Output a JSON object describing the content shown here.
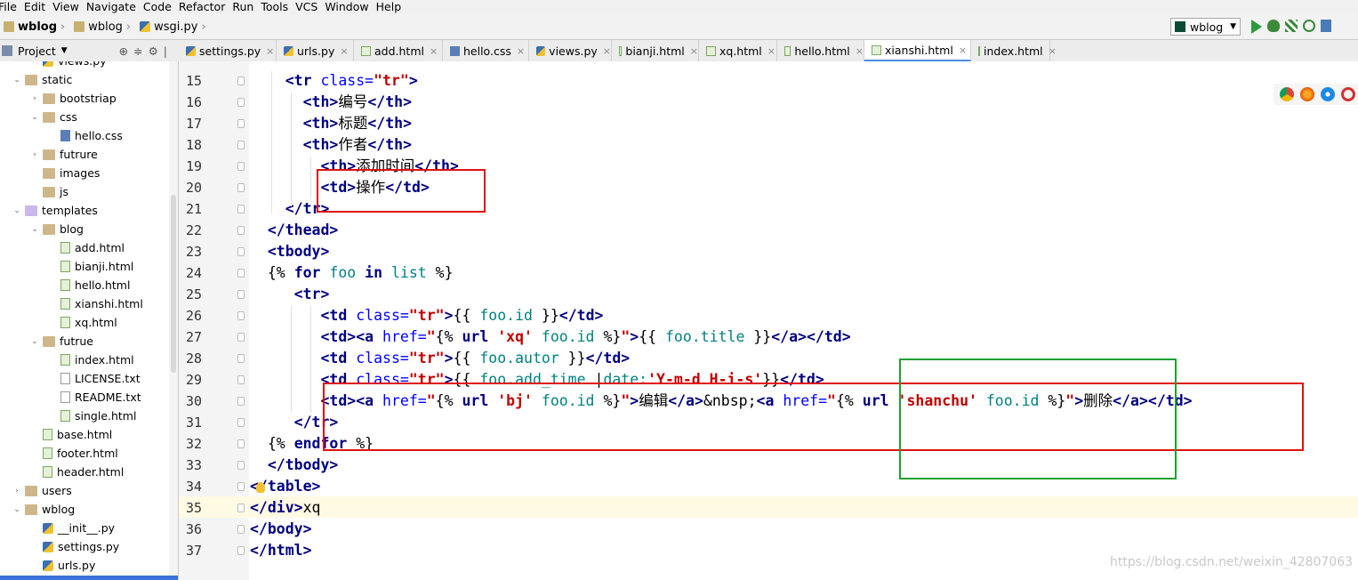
{
  "menu": [
    "File",
    "Edit",
    "View",
    "Navigate",
    "Code",
    "Refactor",
    "Run",
    "Tools",
    "VCS",
    "Window",
    "Help"
  ],
  "breadcrumb": [
    "wblog",
    "wblog",
    "wsgi.py"
  ],
  "run_config": "wblog",
  "project_panel": {
    "label": "Project"
  },
  "tabs": [
    {
      "label": "settings.py",
      "kind": "py"
    },
    {
      "label": "urls.py",
      "kind": "py"
    },
    {
      "label": "add.html",
      "kind": "html"
    },
    {
      "label": "hello.css",
      "kind": "css"
    },
    {
      "label": "views.py",
      "kind": "py"
    },
    {
      "label": "bianji.html",
      "kind": "html"
    },
    {
      "label": "xq.html",
      "kind": "html"
    },
    {
      "label": "hello.html",
      "kind": "html"
    },
    {
      "label": "xianshi.html",
      "kind": "html",
      "active": true
    },
    {
      "label": "index.html",
      "kind": "html"
    }
  ],
  "tree": [
    {
      "label": "views.py",
      "depth": 2,
      "kind": "py"
    },
    {
      "label": "static",
      "depth": 1,
      "kind": "folder",
      "open": true
    },
    {
      "label": "bootstriap",
      "depth": 2,
      "kind": "folder",
      "open": false
    },
    {
      "label": "css",
      "depth": 2,
      "kind": "folder",
      "open": true
    },
    {
      "label": "hello.css",
      "depth": 3,
      "kind": "css"
    },
    {
      "label": "futrure",
      "depth": 2,
      "kind": "folder",
      "open": false
    },
    {
      "label": "images",
      "depth": 2,
      "kind": "folder"
    },
    {
      "label": "js",
      "depth": 2,
      "kind": "folder"
    },
    {
      "label": "templates",
      "depth": 1,
      "kind": "tpl",
      "open": true
    },
    {
      "label": "blog",
      "depth": 2,
      "kind": "folder",
      "open": true
    },
    {
      "label": "add.html",
      "depth": 3,
      "kind": "html"
    },
    {
      "label": "bianji.html",
      "depth": 3,
      "kind": "html"
    },
    {
      "label": "hello.html",
      "depth": 3,
      "kind": "html"
    },
    {
      "label": "xianshi.html",
      "depth": 3,
      "kind": "html"
    },
    {
      "label": "xq.html",
      "depth": 3,
      "kind": "html"
    },
    {
      "label": "futrue",
      "depth": 2,
      "kind": "folder",
      "open": true
    },
    {
      "label": "index.html",
      "depth": 3,
      "kind": "html"
    },
    {
      "label": "LICENSE.txt",
      "depth": 3,
      "kind": "txt"
    },
    {
      "label": "README.txt",
      "depth": 3,
      "kind": "txt"
    },
    {
      "label": "single.html",
      "depth": 3,
      "kind": "html"
    },
    {
      "label": "base.html",
      "depth": 2,
      "kind": "html"
    },
    {
      "label": "footer.html",
      "depth": 2,
      "kind": "html"
    },
    {
      "label": "header.html",
      "depth": 2,
      "kind": "html"
    },
    {
      "label": "users",
      "depth": 1,
      "kind": "folder",
      "open": false
    },
    {
      "label": "wblog",
      "depth": 1,
      "kind": "folder",
      "open": true
    },
    {
      "label": "__init__.py",
      "depth": 2,
      "kind": "py"
    },
    {
      "label": "settings.py",
      "depth": 2,
      "kind": "py"
    },
    {
      "label": "urls.py",
      "depth": 2,
      "kind": "py"
    }
  ],
  "code_lines": [
    {
      "n": "15",
      "indent": "    ",
      "tokens": [
        [
          "tg",
          "<tr "
        ],
        [
          "at",
          "class="
        ],
        [
          "st",
          "\"tr\""
        ],
        [
          "tg",
          ">"
        ]
      ]
    },
    {
      "n": "16",
      "indent": "      ",
      "tokens": [
        [
          "tg",
          "<th>"
        ],
        [
          "tx",
          "编号"
        ],
        [
          "tg",
          "</th>"
        ]
      ]
    },
    {
      "n": "17",
      "indent": "      ",
      "tokens": [
        [
          "tg",
          "<th>"
        ],
        [
          "tx",
          "标题"
        ],
        [
          "tg",
          "</th>"
        ]
      ]
    },
    {
      "n": "18",
      "indent": "      ",
      "tokens": [
        [
          "tg",
          "<th>"
        ],
        [
          "tx",
          "作者"
        ],
        [
          "tg",
          "</th>"
        ]
      ]
    },
    {
      "n": "19",
      "indent": "        ",
      "tokens": [
        [
          "tg",
          "<th>"
        ],
        [
          "tx",
          "添加时间"
        ],
        [
          "tg",
          "</th>"
        ]
      ]
    },
    {
      "n": "20",
      "indent": "        ",
      "tokens": [
        [
          "tg",
          "<td>"
        ],
        [
          "tx",
          "操作"
        ],
        [
          "tg",
          "</td>"
        ]
      ]
    },
    {
      "n": "21",
      "indent": "    ",
      "tokens": [
        [
          "tg",
          "</tr>"
        ]
      ]
    },
    {
      "n": "22",
      "indent": "  ",
      "tokens": [
        [
          "tg",
          "</thead>"
        ]
      ]
    },
    {
      "n": "23",
      "indent": "  ",
      "tokens": [
        [
          "tg",
          "<tbody>"
        ]
      ]
    },
    {
      "n": "24",
      "indent": "  ",
      "tokens": [
        [
          "tx",
          "{% "
        ],
        [
          "kw",
          "for"
        ],
        [
          "vr",
          " foo "
        ],
        [
          "kw",
          "in"
        ],
        [
          "vr",
          " list "
        ],
        [
          "tx",
          "%}"
        ]
      ]
    },
    {
      "n": "25",
      "indent": "     ",
      "tokens": [
        [
          "tg",
          "<tr>"
        ]
      ]
    },
    {
      "n": "26",
      "indent": "        ",
      "tokens": [
        [
          "tg",
          "<td "
        ],
        [
          "at",
          "class="
        ],
        [
          "st",
          "\"tr\""
        ],
        [
          "tg",
          ">"
        ],
        [
          "tx",
          "{{ "
        ],
        [
          "vr",
          "foo.id"
        ],
        [
          "tx",
          " }}"
        ],
        [
          "tg",
          "</td>"
        ]
      ]
    },
    {
      "n": "27",
      "indent": "        ",
      "tokens": [
        [
          "tg",
          "<td><a "
        ],
        [
          "at",
          "href="
        ],
        [
          "st",
          "\""
        ],
        [
          "tx",
          "{% "
        ],
        [
          "kw",
          "url "
        ],
        [
          "st",
          "'xq'"
        ],
        [
          "vr",
          " foo.id "
        ],
        [
          "tx",
          "%}"
        ],
        [
          "st",
          "\""
        ],
        [
          "tg",
          ">"
        ],
        [
          "tx",
          "{{ "
        ],
        [
          "vr",
          "foo.title"
        ],
        [
          "tx",
          " }}"
        ],
        [
          "tg",
          "</a></td>"
        ]
      ]
    },
    {
      "n": "28",
      "indent": "        ",
      "tokens": [
        [
          "tg",
          "<td "
        ],
        [
          "at",
          "class="
        ],
        [
          "st",
          "\"tr\""
        ],
        [
          "tg",
          ">"
        ],
        [
          "tx",
          "{{ "
        ],
        [
          "vr",
          "foo.autor"
        ],
        [
          "tx",
          " }}"
        ],
        [
          "tg",
          "</td>"
        ]
      ]
    },
    {
      "n": "29",
      "indent": "        ",
      "tokens": [
        [
          "tg",
          "<td "
        ],
        [
          "at",
          "class="
        ],
        [
          "st",
          "\"tr\""
        ],
        [
          "tg",
          ">"
        ],
        [
          "tx",
          "{{ "
        ],
        [
          "vr",
          "foo.add_time "
        ],
        [
          "tx",
          "|"
        ],
        [
          "vr",
          "date:"
        ],
        [
          "st",
          "'Y-m-d H-i-s'"
        ],
        [
          "tx",
          "}}"
        ],
        [
          "tg",
          "</td>"
        ]
      ]
    },
    {
      "n": "30",
      "indent": "        ",
      "tokens": [
        [
          "tg",
          "<td><a "
        ],
        [
          "at",
          "href="
        ],
        [
          "st",
          "\""
        ],
        [
          "tx",
          "{% "
        ],
        [
          "kw",
          "url "
        ],
        [
          "st",
          "'bj'"
        ],
        [
          "vr",
          " foo.id "
        ],
        [
          "tx",
          "%}"
        ],
        [
          "st",
          "\""
        ],
        [
          "tg",
          ">"
        ],
        [
          "tx",
          "编辑"
        ],
        [
          "tg",
          "</a>"
        ],
        [
          "ent",
          "&nbsp;"
        ],
        [
          "tg",
          "<a "
        ],
        [
          "at",
          "href="
        ],
        [
          "st",
          "\""
        ],
        [
          "tx",
          "{% "
        ],
        [
          "kw",
          "url "
        ],
        [
          "st",
          "'shanchu'"
        ],
        [
          "vr",
          " foo.id "
        ],
        [
          "tx",
          "%}"
        ],
        [
          "st",
          "\""
        ],
        [
          "tg",
          ">"
        ],
        [
          "tx",
          "删除"
        ],
        [
          "tg",
          "</a></td>"
        ]
      ]
    },
    {
      "n": "31",
      "indent": "     ",
      "tokens": [
        [
          "tg",
          "</tr>"
        ]
      ]
    },
    {
      "n": "32",
      "indent": "  ",
      "tokens": [
        [
          "tx",
          "{% "
        ],
        [
          "kw",
          "endfor"
        ],
        [
          "tx",
          " %}"
        ]
      ]
    },
    {
      "n": "33",
      "indent": "  ",
      "tokens": [
        [
          "tg",
          "</tbody>"
        ]
      ]
    },
    {
      "n": "34",
      "indent": "",
      "tokens": [
        [
          "tg",
          "</table>"
        ]
      ]
    },
    {
      "n": "35",
      "indent": "",
      "tokens": [
        [
          "tg",
          "</div>"
        ],
        [
          "tx",
          "xq"
        ]
      ]
    },
    {
      "n": "36",
      "indent": "",
      "tokens": [
        [
          "tg",
          "</body>"
        ]
      ]
    },
    {
      "n": "37",
      "indent": "",
      "tokens": [
        [
          "tg",
          "</html>"
        ]
      ]
    }
  ],
  "watermark": "https://blog.csdn.net/weixin_42807063",
  "colors": {
    "accent": "#4a8fe0",
    "highlight_red": "#e01010",
    "highlight_green": "#20a030",
    "current_line": "#fffae3"
  }
}
